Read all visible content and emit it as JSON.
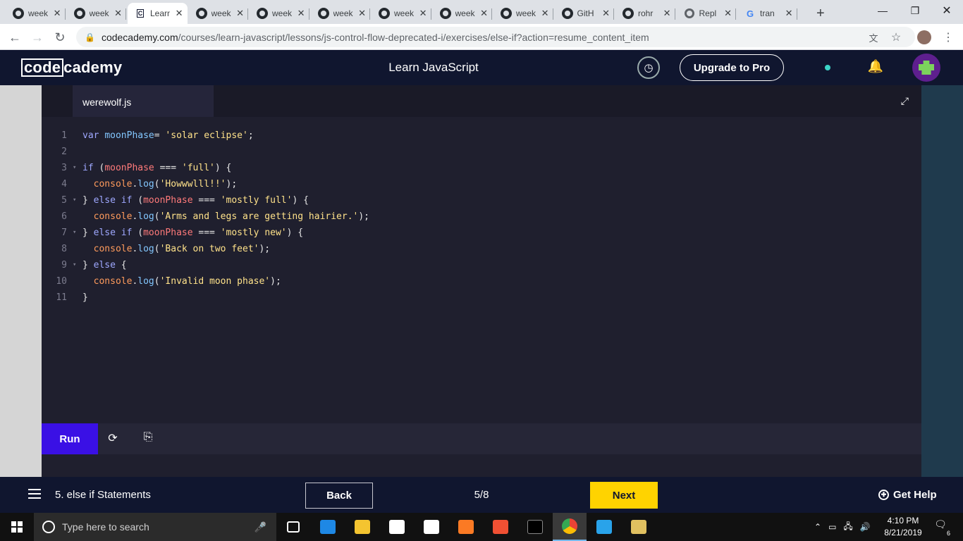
{
  "browser": {
    "tabs": [
      {
        "title": "week",
        "icon": "github-icon"
      },
      {
        "title": "week",
        "icon": "github-icon"
      },
      {
        "title": "Learn",
        "icon": "codecademy-icon",
        "active": true
      },
      {
        "title": "week",
        "icon": "github-icon"
      },
      {
        "title": "week",
        "icon": "github-icon"
      },
      {
        "title": "week",
        "icon": "github-icon"
      },
      {
        "title": "week",
        "icon": "github-icon"
      },
      {
        "title": "week",
        "icon": "github-icon"
      },
      {
        "title": "week",
        "icon": "github-icon"
      },
      {
        "title": "GitH",
        "icon": "github-icon"
      },
      {
        "title": "rohr",
        "icon": "github-icon"
      },
      {
        "title": "Repl",
        "icon": "replit-icon"
      },
      {
        "title": "tran",
        "icon": "google-icon"
      }
    ],
    "new_tab": "+",
    "url_host": "codecademy.com",
    "url_path": "/courses/learn-javascript/lessons/js-control-flow-deprecated-i/exercises/else-if?action=resume_content_item"
  },
  "header": {
    "logo_box": "code",
    "logo_rest": "cademy",
    "course_title": "Learn JavaScript",
    "upgrade_label": "Upgrade to Pro"
  },
  "editor": {
    "file_name": "werewolf.js",
    "run_label": "Run",
    "lines": [
      {
        "n": "1",
        "fold": false
      },
      {
        "n": "2",
        "fold": false
      },
      {
        "n": "3",
        "fold": true
      },
      {
        "n": "4",
        "fold": false
      },
      {
        "n": "5",
        "fold": true
      },
      {
        "n": "6",
        "fold": false
      },
      {
        "n": "7",
        "fold": true
      },
      {
        "n": "8",
        "fold": false
      },
      {
        "n": "9",
        "fold": true
      },
      {
        "n": "10",
        "fold": false
      },
      {
        "n": "11",
        "fold": false
      }
    ],
    "tokens": [
      [
        [
          "kw",
          "var "
        ],
        [
          "mt",
          "moonPhase"
        ],
        [
          "",
          "= "
        ],
        [
          "st",
          "'solar eclipse'"
        ],
        [
          "",
          ";"
        ]
      ],
      [],
      [
        [
          "kw",
          "if "
        ],
        [
          "",
          "("
        ],
        [
          "vr",
          "moonPhase"
        ],
        [
          "",
          " === "
        ],
        [
          "st",
          "'full'"
        ],
        [
          "",
          ") {"
        ]
      ],
      [
        [
          "",
          "  "
        ],
        [
          "fn",
          "console"
        ],
        [
          "",
          "."
        ],
        [
          "mt",
          "log"
        ],
        [
          "",
          "("
        ],
        [
          "st",
          "'Howwwlll!!'"
        ],
        [
          "",
          ");"
        ]
      ],
      [
        [
          "",
          "} "
        ],
        [
          "kw",
          "else if "
        ],
        [
          "",
          "("
        ],
        [
          "vr",
          "moonPhase"
        ],
        [
          "",
          " === "
        ],
        [
          "st",
          "'mostly full'"
        ],
        [
          "",
          ") {"
        ]
      ],
      [
        [
          "",
          "  "
        ],
        [
          "fn",
          "console"
        ],
        [
          "",
          "."
        ],
        [
          "mt",
          "log"
        ],
        [
          "",
          "("
        ],
        [
          "st",
          "'Arms and legs are getting hairier.'"
        ],
        [
          "",
          ");"
        ]
      ],
      [
        [
          "",
          "} "
        ],
        [
          "kw",
          "else if "
        ],
        [
          "",
          "("
        ],
        [
          "vr",
          "moonPhase"
        ],
        [
          "",
          " === "
        ],
        [
          "st",
          "'mostly new'"
        ],
        [
          "",
          ") {"
        ]
      ],
      [
        [
          "",
          "  "
        ],
        [
          "fn",
          "console"
        ],
        [
          "",
          "."
        ],
        [
          "mt",
          "log"
        ],
        [
          "",
          "("
        ],
        [
          "st",
          "'Back on two feet'"
        ],
        [
          "",
          ");"
        ]
      ],
      [
        [
          "",
          "} "
        ],
        [
          "kw",
          "else "
        ],
        [
          "",
          "{"
        ]
      ],
      [
        [
          "",
          "  "
        ],
        [
          "fn",
          "console"
        ],
        [
          "",
          "."
        ],
        [
          "mt",
          "log"
        ],
        [
          "",
          "("
        ],
        [
          "st",
          "'Invalid moon phase'"
        ],
        [
          "",
          ");"
        ]
      ],
      [
        [
          "",
          "}"
        ]
      ]
    ]
  },
  "footer": {
    "lesson": "5. else if Statements",
    "back_label": "Back",
    "progress": "5/8",
    "next_label": "Next",
    "help_label": "Get Help"
  },
  "taskbar": {
    "search_placeholder": "Type here to search",
    "time": "4:10 PM",
    "date": "8/21/2019",
    "notification_count": "6",
    "apps": [
      {
        "name": "task-view-icon",
        "color": "#ffffff"
      },
      {
        "name": "edge-icon",
        "color": "#1e88e5"
      },
      {
        "name": "file-explorer-icon",
        "color": "#f4c430"
      },
      {
        "name": "store-icon",
        "color": "#ffffff"
      },
      {
        "name": "mail-icon",
        "color": "#ffffff"
      },
      {
        "name": "xampp-icon",
        "color": "#fb7a24"
      },
      {
        "name": "git-icon",
        "color": "#f05033"
      },
      {
        "name": "terminal-icon",
        "color": "#888888"
      },
      {
        "name": "chrome-icon",
        "color": "#4caf50"
      },
      {
        "name": "vscode-icon",
        "color": "#29a3ea"
      },
      {
        "name": "paint-icon",
        "color": "#e0c060"
      }
    ]
  }
}
